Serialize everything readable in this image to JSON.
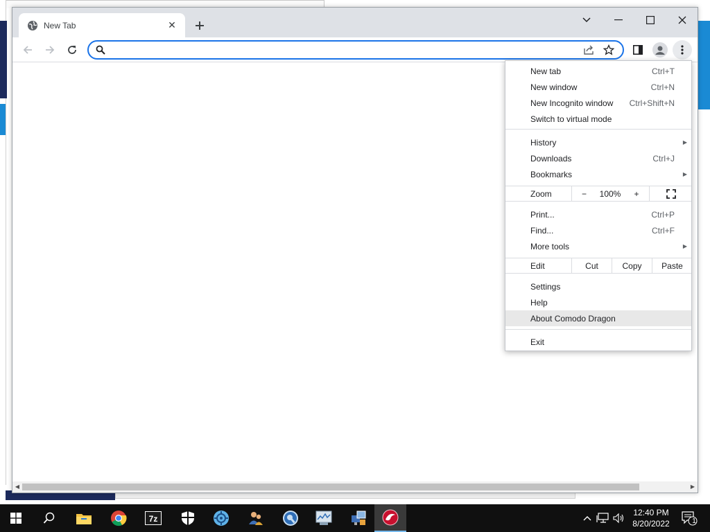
{
  "tab": {
    "title": "New Tab"
  },
  "omnibox": {
    "value": "",
    "placeholder": ""
  },
  "menu": {
    "sections": [
      [
        {
          "label": "New tab",
          "shortcut": "Ctrl+T"
        },
        {
          "label": "New window",
          "shortcut": "Ctrl+N"
        },
        {
          "label": "New Incognito window",
          "shortcut": "Ctrl+Shift+N"
        },
        {
          "label": "Switch to virtual mode",
          "shortcut": ""
        }
      ],
      [
        {
          "label": "History",
          "shortcut": "",
          "submenu": true
        },
        {
          "label": "Downloads",
          "shortcut": "Ctrl+J"
        },
        {
          "label": "Bookmarks",
          "shortcut": "",
          "submenu": true
        }
      ]
    ],
    "zoom": {
      "label": "Zoom",
      "minus": "−",
      "value": "100%",
      "plus": "+"
    },
    "tools": [
      {
        "label": "Print...",
        "shortcut": "Ctrl+P"
      },
      {
        "label": "Find...",
        "shortcut": "Ctrl+F"
      },
      {
        "label": "More tools",
        "shortcut": "",
        "submenu": true
      }
    ],
    "edit": {
      "label": "Edit",
      "cut": "Cut",
      "copy": "Copy",
      "paste": "Paste"
    },
    "bottom": [
      {
        "label": "Settings",
        "shortcut": ""
      },
      {
        "label": "Help",
        "shortcut": ""
      },
      {
        "label": "About Comodo Dragon",
        "shortcut": "",
        "highlighted": true
      }
    ],
    "exit": {
      "label": "Exit"
    }
  },
  "taskbar": {
    "pinned": [
      "windows-start",
      "search",
      "file-explorer",
      "chrome",
      "7zip",
      "windows-security",
      "app-settings",
      "users",
      "qbittorrent",
      "performance-monitor",
      "network-config",
      "comodo-dragon"
    ],
    "tray": {
      "time": "12:40 PM",
      "date": "8/20/2022",
      "notification_count": "1"
    }
  },
  "colors": {
    "accent": "#1a73e8",
    "taskbar": "#101010",
    "titlebar": "#dee1e6"
  }
}
